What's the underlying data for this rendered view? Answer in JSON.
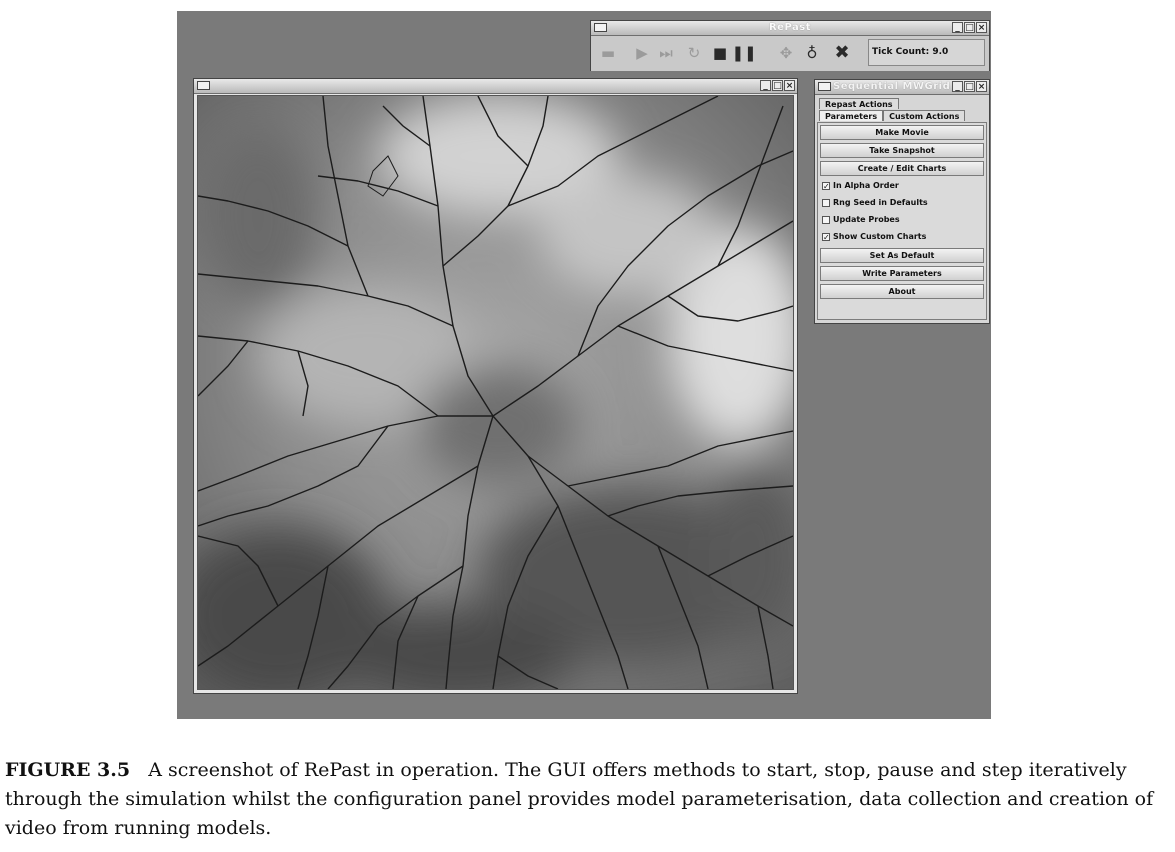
{
  "toolbar_window": {
    "title": "RePast",
    "controls": [
      "minimize-icon",
      "maximize-icon",
      "close-icon"
    ],
    "buttons": [
      {
        "icon": "setup-icon",
        "enabled": false
      },
      {
        "icon": "play-icon",
        "enabled": false
      },
      {
        "icon": "step-icon",
        "enabled": false
      },
      {
        "icon": "reset-icon",
        "enabled": false
      },
      {
        "icon": "stop-icon",
        "enabled": true
      },
      {
        "icon": "pause-icon",
        "enabled": true
      },
      {
        "icon": "load-icon",
        "enabled": false
      },
      {
        "icon": "lightbulb-icon",
        "enabled": true
      },
      {
        "icon": "exit-icon",
        "enabled": true
      }
    ],
    "tick_count": "Tick Count: 9.0"
  },
  "display_window": {
    "title": "",
    "content": "terrain-heightmap-with-drainage-network",
    "controls": [
      "minimize-icon",
      "maximize-icon",
      "close-icon"
    ]
  },
  "controls_window": {
    "title": "Sequential MWGrid",
    "tabs_back": [
      "Repast Actions"
    ],
    "tabs_front": [
      "Parameters",
      "Custom Actions"
    ],
    "buttons": [
      "Make Movie",
      "Take Snapshot",
      "Create / Edit Charts",
      "Set As Default",
      "Write Parameters",
      "About"
    ],
    "checkboxes": [
      {
        "label": "In Alpha Order",
        "checked": true
      },
      {
        "label": "Rng Seed in Defaults",
        "checked": false
      },
      {
        "label": "Update Probes",
        "checked": false
      },
      {
        "label": "Show Custom Charts",
        "checked": true
      }
    ]
  },
  "caption": {
    "label": "FIGURE 3.5",
    "text": "A screenshot of RePast in operation. The GUI offers methods to start, stop, pause and step iteratively through the simulation whilst the configuration panel provides model parameterisation, data collection and creation of video from running models."
  },
  "colors": {
    "desktop": "#7a7a7a",
    "window": "#d8d8d8",
    "drainage": "#1c1c1c"
  }
}
